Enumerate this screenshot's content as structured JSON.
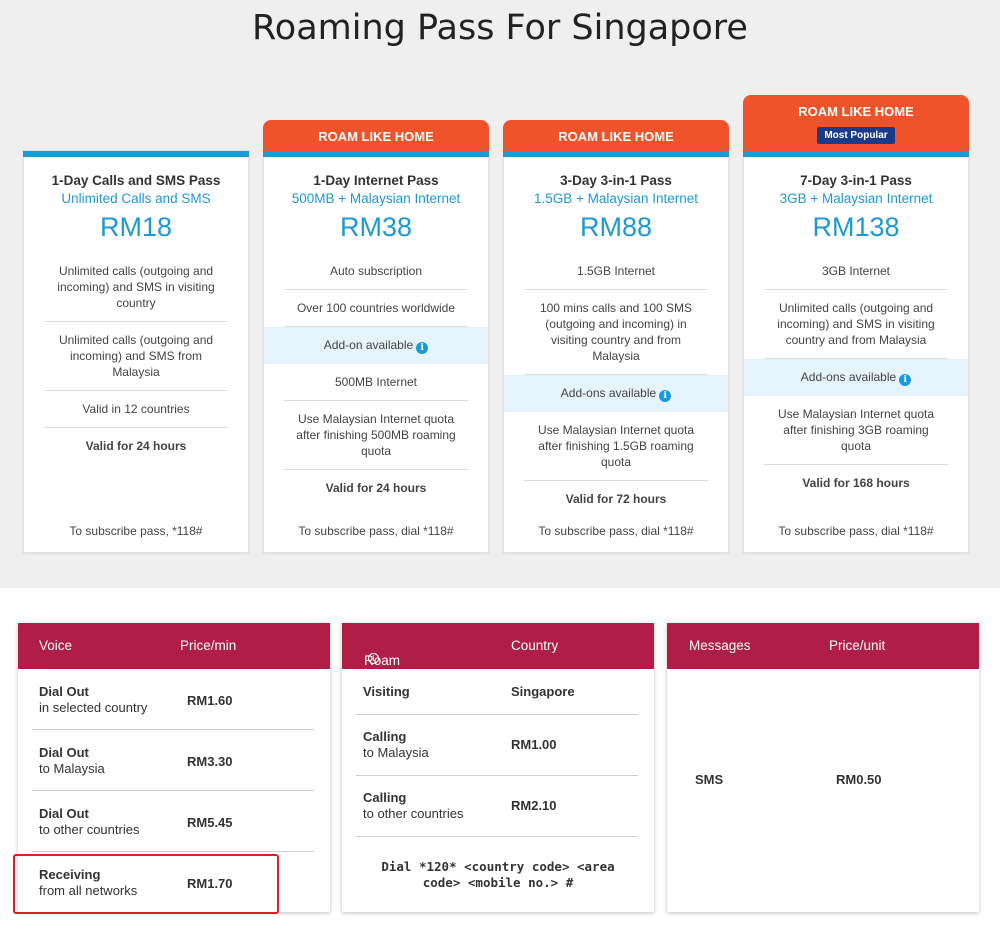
{
  "page_title": "Roaming Pass For Singapore",
  "cards": [
    {
      "header": null,
      "name": "1-Day Calls and SMS Pass",
      "subtitle": "Unlimited Calls and SMS",
      "price": "RM18",
      "features": [
        "Unlimited calls (outgoing and incoming) and SMS in visiting country",
        "Unlimited calls (outgoing and incoming) and SMS from Malaysia",
        "Valid in 12 countries"
      ],
      "validity": "Valid for 24 hours",
      "subscribe": "To subscribe pass, *118#"
    },
    {
      "header": "ROAM LIKE HOME",
      "name": "1-Day Internet Pass",
      "subtitle": "500MB + Malaysian Internet",
      "price": "RM38",
      "features": [
        "Auto subscription",
        "Over 100 countries worldwide"
      ],
      "addon": "Add-on available",
      "features_after": [
        "500MB Internet",
        "Use Malaysian Internet quota after finishing 500MB roaming quota"
      ],
      "validity": "Valid for 24 hours",
      "subscribe": "To subscribe pass, dial *118#"
    },
    {
      "header": "ROAM LIKE HOME",
      "name": "3-Day 3-in-1 Pass",
      "subtitle": "1.5GB + Malaysian Internet",
      "price": "RM88",
      "features": [
        "1.5GB Internet",
        "100 mins calls and 100 SMS (outgoing and incoming) in visiting country and from Malaysia"
      ],
      "addon": "Add-ons available",
      "features_after": [
        "Use Malaysian Internet quota after finishing 1.5GB roaming quota"
      ],
      "validity": "Valid for 72 hours",
      "subscribe": "To subscribe pass, dial *118#"
    },
    {
      "header": "ROAM LIKE HOME",
      "badge": "Most Popular",
      "name": "7-Day 3-in-1 Pass",
      "subtitle": "3GB + Malaysian Internet",
      "price": "RM138",
      "features": [
        "3GB Internet",
        "Unlimited calls (outgoing and incoming) and SMS in visiting country and from Malaysia"
      ],
      "addon": "Add-ons available",
      "features_after": [
        "Use Malaysian Internet quota after finishing 3GB roaming quota"
      ],
      "validity": "Valid for 168 hours",
      "subscribe": "To subscribe pass, dial *118#"
    }
  ],
  "voice_table": {
    "col1": "Voice",
    "col2": "Price/min",
    "rows": [
      {
        "title": "Dial Out",
        "sub": "in selected country",
        "price": "RM1.60"
      },
      {
        "title": "Dial Out",
        "sub": "to Malaysia",
        "price": "RM3.30"
      },
      {
        "title": "Dial Out",
        "sub": "to other countries",
        "price": "RM5.45"
      },
      {
        "title": "Receiving",
        "sub": "from all networks",
        "price": "RM1.70"
      }
    ]
  },
  "roam_saver_table": {
    "col1": "Roam Saver",
    "col2": "Country",
    "visiting_label": "Visiting",
    "visiting_value": "Singapore",
    "rows": [
      {
        "title": "Calling",
        "sub": "to Malaysia",
        "price": "RM1.00"
      },
      {
        "title": "Calling",
        "sub": "to other countries",
        "price": "RM2.10"
      }
    ],
    "note": "Dial *120* <country code> <area code> <mobile no.> #"
  },
  "messages_table": {
    "col1": "Messages",
    "col2": "Price/unit",
    "label": "SMS",
    "price": "RM0.50"
  },
  "colors": {
    "accent_blue": "#1c9ad6",
    "header_orange": "#f0532a",
    "table_header": "#b01e47",
    "badge_navy": "#1a3a8a",
    "highlight_red": "#d8202a"
  }
}
